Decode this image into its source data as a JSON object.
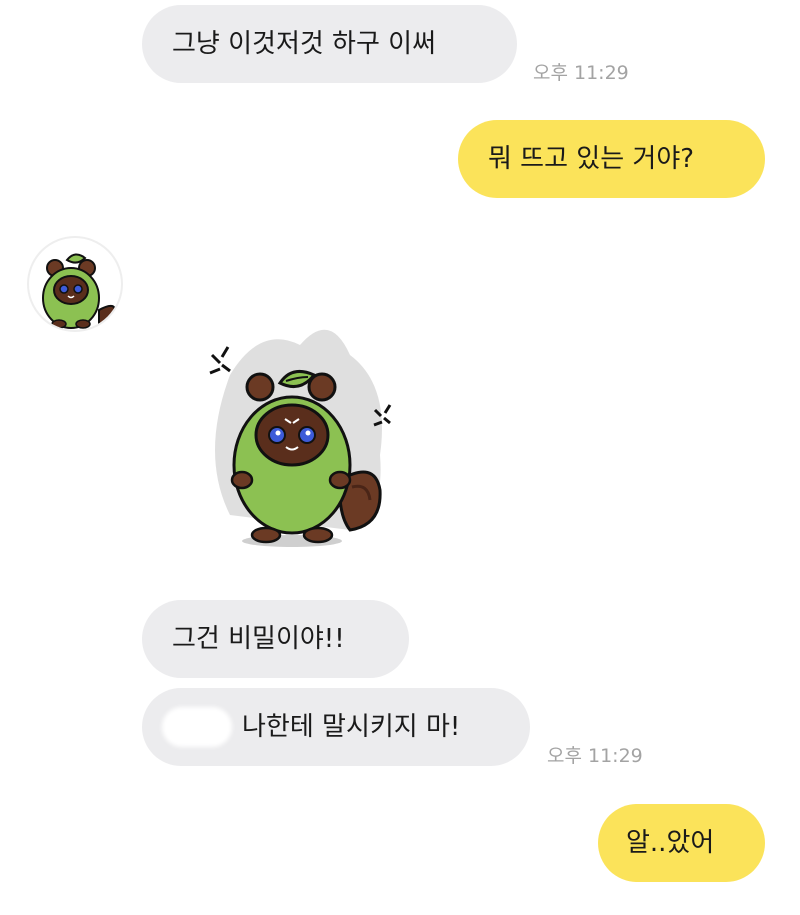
{
  "messages": [
    {
      "text": "그냥 이것저것 하구 이써"
    },
    {
      "text": "뭐 뜨고 있는 거야?"
    },
    {
      "text": "그건 비밀이야!!"
    },
    {
      "text": "나한테 말시키지 마!"
    },
    {
      "text": "알..았어"
    }
  ],
  "timestamps": {
    "t1": "오후 11:29",
    "t2": "오후 11:29"
  },
  "colors": {
    "incoming": "#ececee",
    "outgoing": "#fbe35a",
    "background": "#ffffff"
  },
  "icons": {
    "avatar": "green-raccoon-avatar-icon",
    "sticker": "angry-raccoon-sticker-icon"
  }
}
